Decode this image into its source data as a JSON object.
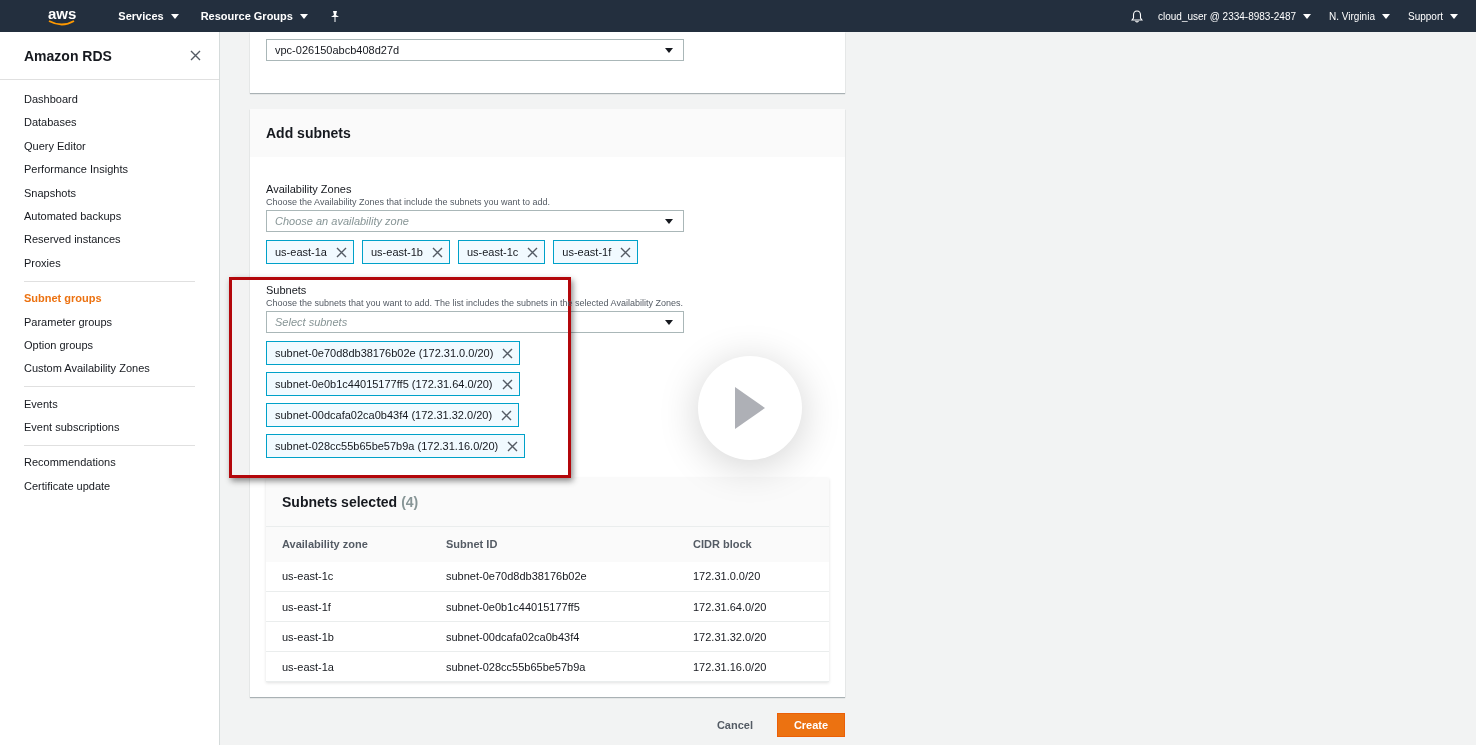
{
  "top_nav": {
    "logo": "aws",
    "menus": [
      {
        "label": "Services"
      },
      {
        "label": "Resource Groups"
      }
    ],
    "account": "cloud_user @ 2334-8983-2487",
    "region": "N. Virginia",
    "support": "Support"
  },
  "sidebar": {
    "title": "Amazon RDS",
    "groups": [
      {
        "items": [
          {
            "label": "Dashboard",
            "selected": false
          },
          {
            "label": "Databases",
            "selected": false
          },
          {
            "label": "Query Editor",
            "selected": false
          },
          {
            "label": "Performance Insights",
            "selected": false
          },
          {
            "label": "Snapshots",
            "selected": false
          },
          {
            "label": "Automated backups",
            "selected": false
          },
          {
            "label": "Reserved instances",
            "selected": false
          },
          {
            "label": "Proxies",
            "selected": false
          }
        ]
      },
      {
        "items": [
          {
            "label": "Subnet groups",
            "selected": true
          },
          {
            "label": "Parameter groups",
            "selected": false
          },
          {
            "label": "Option groups",
            "selected": false
          },
          {
            "label": "Custom Availability Zones",
            "selected": false
          }
        ]
      },
      {
        "items": [
          {
            "label": "Events",
            "selected": false
          },
          {
            "label": "Event subscriptions",
            "selected": false
          }
        ]
      },
      {
        "items": [
          {
            "label": "Recommendations",
            "selected": false
          },
          {
            "label": "Certificate update",
            "selected": false
          }
        ]
      }
    ]
  },
  "vpc_select": {
    "value": "vpc-026150abcb408d27d"
  },
  "add_subnets": {
    "title": "Add subnets",
    "fields": [
      {
        "label": "Availability Zones",
        "description": "Choose the Availability Zones that include the subnets you want to add.",
        "placeholder": "Choose an availability zone",
        "kind": "row",
        "tokens": [
          "us-east-1a",
          "us-east-1b",
          "us-east-1c",
          "us-east-1f"
        ]
      },
      {
        "label": "Subnets",
        "description": "Choose the subnets that you want to add. The list includes the subnets in the selected Availability Zones.",
        "placeholder": "Select subnets",
        "kind": "column",
        "tokens": [
          "subnet-0e70d8db38176b02e (172.31.0.0/20)",
          "subnet-0e0b1c44015177ff5 (172.31.64.0/20)",
          "subnet-00dcafa02ca0b43f4 (172.31.32.0/20)",
          "subnet-028cc55b65be57b9a (172.31.16.0/20)"
        ]
      }
    ],
    "selected_table": {
      "title": "Subnets selected",
      "count": "(4)",
      "columns": [
        "Availability zone",
        "Subnet ID",
        "CIDR block"
      ],
      "rows": [
        [
          "us-east-1c",
          "subnet-0e70d8db38176b02e",
          "172.31.0.0/20"
        ],
        [
          "us-east-1f",
          "subnet-0e0b1c44015177ff5",
          "172.31.64.0/20"
        ],
        [
          "us-east-1b",
          "subnet-00dcafa02ca0b43f4",
          "172.31.32.0/20"
        ],
        [
          "us-east-1a",
          "subnet-028cc55b65be57b9a",
          "172.31.16.0/20"
        ]
      ]
    }
  },
  "footer": {
    "buttons": [
      {
        "label": "Cancel",
        "kind": "link"
      },
      {
        "label": "Create",
        "kind": "primary"
      }
    ]
  }
}
